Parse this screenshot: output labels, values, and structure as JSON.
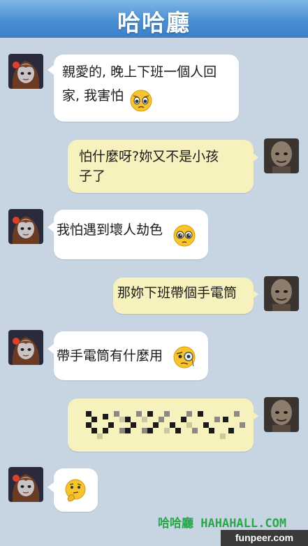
{
  "app": {
    "title": "哈哈廳"
  },
  "messages": [
    {
      "sender": "girl",
      "text": "親愛的, 晚上下班一個人回\n家, 我害怕",
      "emoji": "worried-face"
    },
    {
      "sender": "monster",
      "text": "怕什麼呀?妳又不是小孩\n子了"
    },
    {
      "sender": "girl",
      "text": "我怕遇到壞人劫色",
      "emoji": "pleading-face"
    },
    {
      "sender": "monster",
      "text": "那妳下班帶個手電筒"
    },
    {
      "sender": "girl",
      "text": "帶手電筒有什麼用",
      "emoji": "monocle-face"
    },
    {
      "sender": "monster",
      "text": "",
      "content": "pixelated-censored"
    },
    {
      "sender": "girl",
      "text": "",
      "emoji": "thinking-face"
    }
  ],
  "watermark": {
    "cn": "哈哈廳",
    "en": "HAHAHALL.COM"
  },
  "source": {
    "label": "funpeer.com"
  },
  "colors": {
    "header": "#4b8fd3",
    "bg": "#c7d5e2",
    "bubble_in": "#ffffff",
    "bubble_out": "#f7f2bd",
    "watermark": "#2aa74a"
  }
}
